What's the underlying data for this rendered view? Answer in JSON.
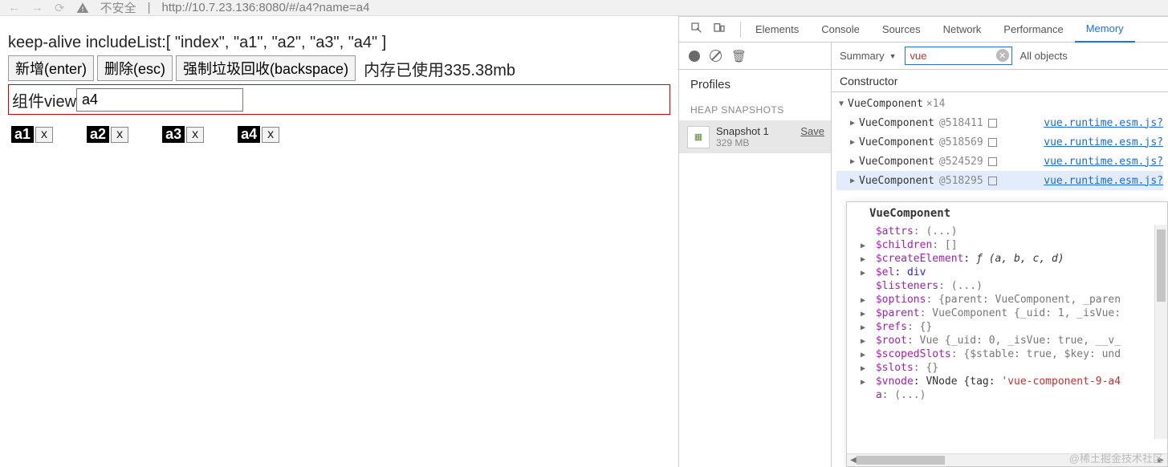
{
  "browser": {
    "insecure_label": "不安全",
    "url": "http://10.7.23.136:8080/#/a4?name=a4"
  },
  "app": {
    "include_line": "keep-alive includeList:[ \"index\", \"a1\", \"a2\", \"a3\", \"a4\" ]",
    "btn_add": "新增(enter)",
    "btn_del": "删除(esc)",
    "btn_gc": "强制垃圾回收(backspace)",
    "mem_text": "内存已使用335.38mb",
    "view_label": "组件view",
    "view_value": "a4",
    "tabs": [
      {
        "label": "a1",
        "close": "x"
      },
      {
        "label": "a2",
        "close": "x"
      },
      {
        "label": "a3",
        "close": "x"
      },
      {
        "label": "a4",
        "close": "x"
      }
    ]
  },
  "devtools": {
    "tabs": [
      "Elements",
      "Console",
      "Sources",
      "Network",
      "Performance",
      "Memory"
    ],
    "active_tab": "Memory",
    "profiles": {
      "title": "Profiles",
      "heap_label": "HEAP SNAPSHOTS",
      "snapshot": {
        "name": "Snapshot 1",
        "size": "329 MB",
        "save": "Save"
      }
    },
    "heap": {
      "summary": "Summary",
      "filter": "vue",
      "all_objects": "All objects",
      "constructor_header": "Constructor",
      "root": {
        "name": "VueComponent",
        "count": "×14"
      },
      "rows": [
        {
          "name": "VueComponent",
          "id": "@518411",
          "src": "vue.runtime.esm.js?"
        },
        {
          "name": "VueComponent",
          "id": "@518569",
          "src": "vue.runtime.esm.js?"
        },
        {
          "name": "VueComponent",
          "id": "@524529",
          "src": "vue.runtime.esm.js?"
        },
        {
          "name": "VueComponent",
          "id": "@518295",
          "src": "vue.runtime.esm.js?"
        }
      ],
      "ghost_links_count": 11,
      "ghost_link_text": "s?"
    },
    "props": {
      "title": "VueComponent",
      "lines": [
        {
          "tw": "",
          "key": "$attrs",
          "rest": ": (...)"
        },
        {
          "tw": "▶",
          "key": "$children",
          "rest": ": []"
        },
        {
          "tw": "▶",
          "key": "$createElement",
          "rest": ": ",
          "fn": "ƒ (a, b, c, d)"
        },
        {
          "tw": "▶",
          "key": "$el",
          "rest": ": ",
          "blue": "div"
        },
        {
          "tw": "",
          "key": "$listeners",
          "rest": ": (...)"
        },
        {
          "tw": "▶",
          "key": "$options",
          "rest": ": {parent: VueComponent, _paren"
        },
        {
          "tw": "▶",
          "key": "$parent",
          "rest": ": VueComponent {_uid: 1, _isVue:"
        },
        {
          "tw": "▶",
          "key": "$refs",
          "rest": ": {}"
        },
        {
          "tw": "▶",
          "key": "$root",
          "rest": ": Vue {_uid: 0, _isVue: true, __v_"
        },
        {
          "tw": "▶",
          "key": "$scopedSlots",
          "rest": ": {$stable: true, $key: und"
        },
        {
          "tw": "▶",
          "key": "$slots",
          "rest": ": {}"
        },
        {
          "tw": "▶",
          "key": "$vnode",
          "rest": ": VNode {tag: ",
          "str": "'vue-component-9-a4"
        },
        {
          "tw": "",
          "key": "a",
          "rest": ": (...)"
        }
      ]
    }
  },
  "watermark": "@稀土掘金技术社区"
}
